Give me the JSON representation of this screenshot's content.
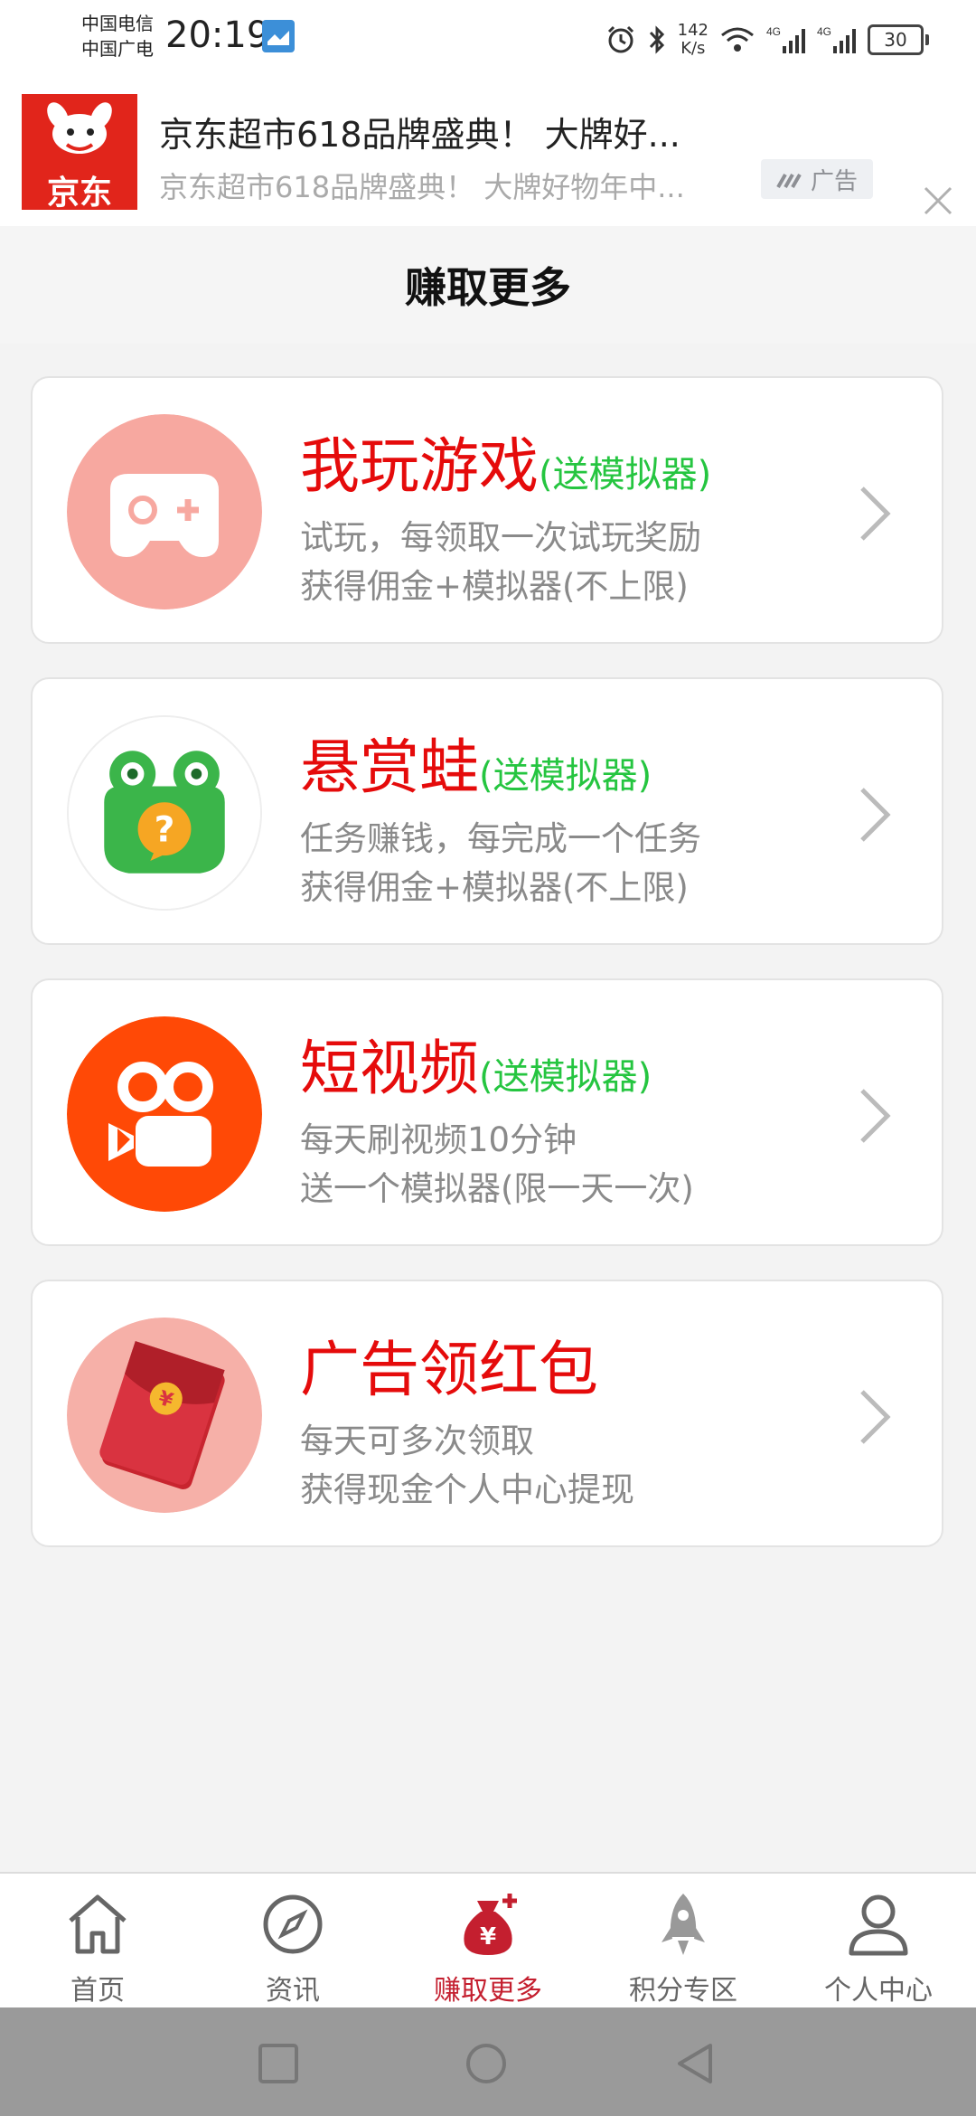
{
  "status_bar": {
    "carrier_1": "中国电信",
    "carrier_2": "中国广电",
    "time": "20:19",
    "net_speed_value": "142",
    "net_speed_unit": "K/s",
    "battery": "30",
    "icons": [
      "app-notification-icon",
      "alarm-icon",
      "bluetooth-icon",
      "wifi-icon",
      "signal-4g-icon",
      "signal-4g-icon",
      "battery-icon"
    ]
  },
  "ad": {
    "brand": "京东",
    "title": "京东超市618品牌盛典！ 大牌好...",
    "subtitle": "京东超市618品牌盛典！ 大牌好物年中...",
    "tag": "广告",
    "brand_color": "#e1251b"
  },
  "header": {
    "title": "赚取更多"
  },
  "cards": [
    {
      "title": "我玩游戏",
      "tag": "(送模拟器)",
      "line1": "试玩，每领取一次试玩奖励",
      "line2": "获得佣金+模拟器(不上限)",
      "icon": "gamepad-icon"
    },
    {
      "title": "悬赏蛙",
      "tag": "(送模拟器)",
      "line1": "任务赚钱，每完成一个任务",
      "line2": "获得佣金+模拟器(不上限)",
      "icon": "frog-icon"
    },
    {
      "title": "短视频",
      "tag": "(送模拟器)",
      "line1": "每天刷视频10分钟",
      "line2": "送一个模拟器(限一天一次)",
      "icon": "video-camera-icon"
    },
    {
      "title": "广告领红包",
      "tag": "",
      "line1": "每天可多次领取",
      "line2": "获得现金个人中心提现",
      "icon": "red-envelope-icon"
    }
  ],
  "nav": [
    {
      "label": "首页",
      "icon": "home-icon",
      "active": false
    },
    {
      "label": "资讯",
      "icon": "compass-icon",
      "active": false
    },
    {
      "label": "赚取更多",
      "icon": "money-bag-icon",
      "active": true
    },
    {
      "label": "积分专区",
      "icon": "rocket-icon",
      "active": false
    },
    {
      "label": "个人中心",
      "icon": "user-icon",
      "active": false
    }
  ],
  "colors": {
    "title_red": "#e50b0b",
    "tag_green": "#25c540",
    "desc_gray": "#8a8a8a",
    "nav_active": "#c41f2f"
  }
}
